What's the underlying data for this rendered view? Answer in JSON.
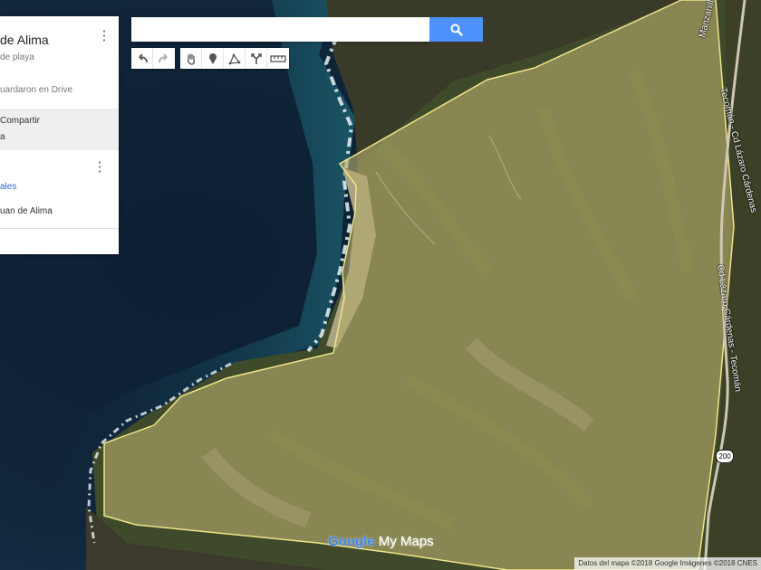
{
  "panel": {
    "map_title": "de Alima",
    "subtitle": "de playa",
    "drive_status": "uardaron en Drive",
    "share_label": "Compartir",
    "view_label": "a",
    "layer_label": "ales",
    "place_item": "uan de Alima",
    "kebab": "⋮"
  },
  "search": {
    "value": "",
    "placeholder": ""
  },
  "toolbar": {
    "undo": "undo-icon",
    "redo": "redo-icon",
    "pan": "hand-icon",
    "marker": "marker-icon",
    "line": "draw-line-icon",
    "directions": "directions-icon",
    "measure": "ruler-icon"
  },
  "roads": {
    "manzanillo": "Manzanillo - Z",
    "tecoman_top": "Tecomán - Cd Lázaro Cárdenas",
    "cardenas_bottom": "Cd Lázaro Cárdenas - Tecomán",
    "shield": "200"
  },
  "logo": {
    "google": "Google",
    "mymaps": " My Maps"
  },
  "attribution": "Datos del mapa ©2018 Google Imágenes ©2018 CNES",
  "colors": {
    "ocean": "#0f2233",
    "polygon_fill": "#b5ab6a",
    "polygon_stroke": "#ede58a",
    "search_button": "#4d90fe"
  }
}
